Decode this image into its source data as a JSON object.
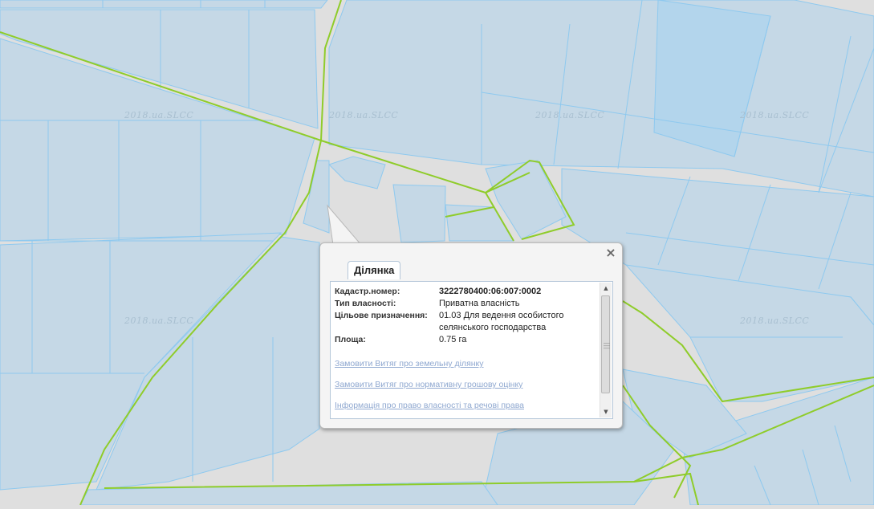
{
  "map": {
    "watermark": "2018.ua.SLCC",
    "colors": {
      "road": "#dfdfdf",
      "parcel_fill": "#c5d8e6",
      "parcel_highlight": "#b3d5ec",
      "parcel_border": "#8ec9ef",
      "boundary_line": "#8fcc2a"
    }
  },
  "popup": {
    "tab_label": "Ділянка",
    "close_label": "×",
    "fields": [
      {
        "label": "Кадастр.номер:",
        "value": "3222780400:06:007:0002"
      },
      {
        "label": "Тип власності:",
        "value": "Приватна власність"
      },
      {
        "label": "Цільове призначення:",
        "value": "01.03 Для ведення особистого селянського господарства"
      },
      {
        "label": "Площа:",
        "value": "0.75 га"
      }
    ],
    "links": [
      "Замовити Витяг про земельну ділянку",
      "Замовити Витяг про нормативну грошову оцінку",
      "Інформація про право власності та речові права"
    ]
  }
}
